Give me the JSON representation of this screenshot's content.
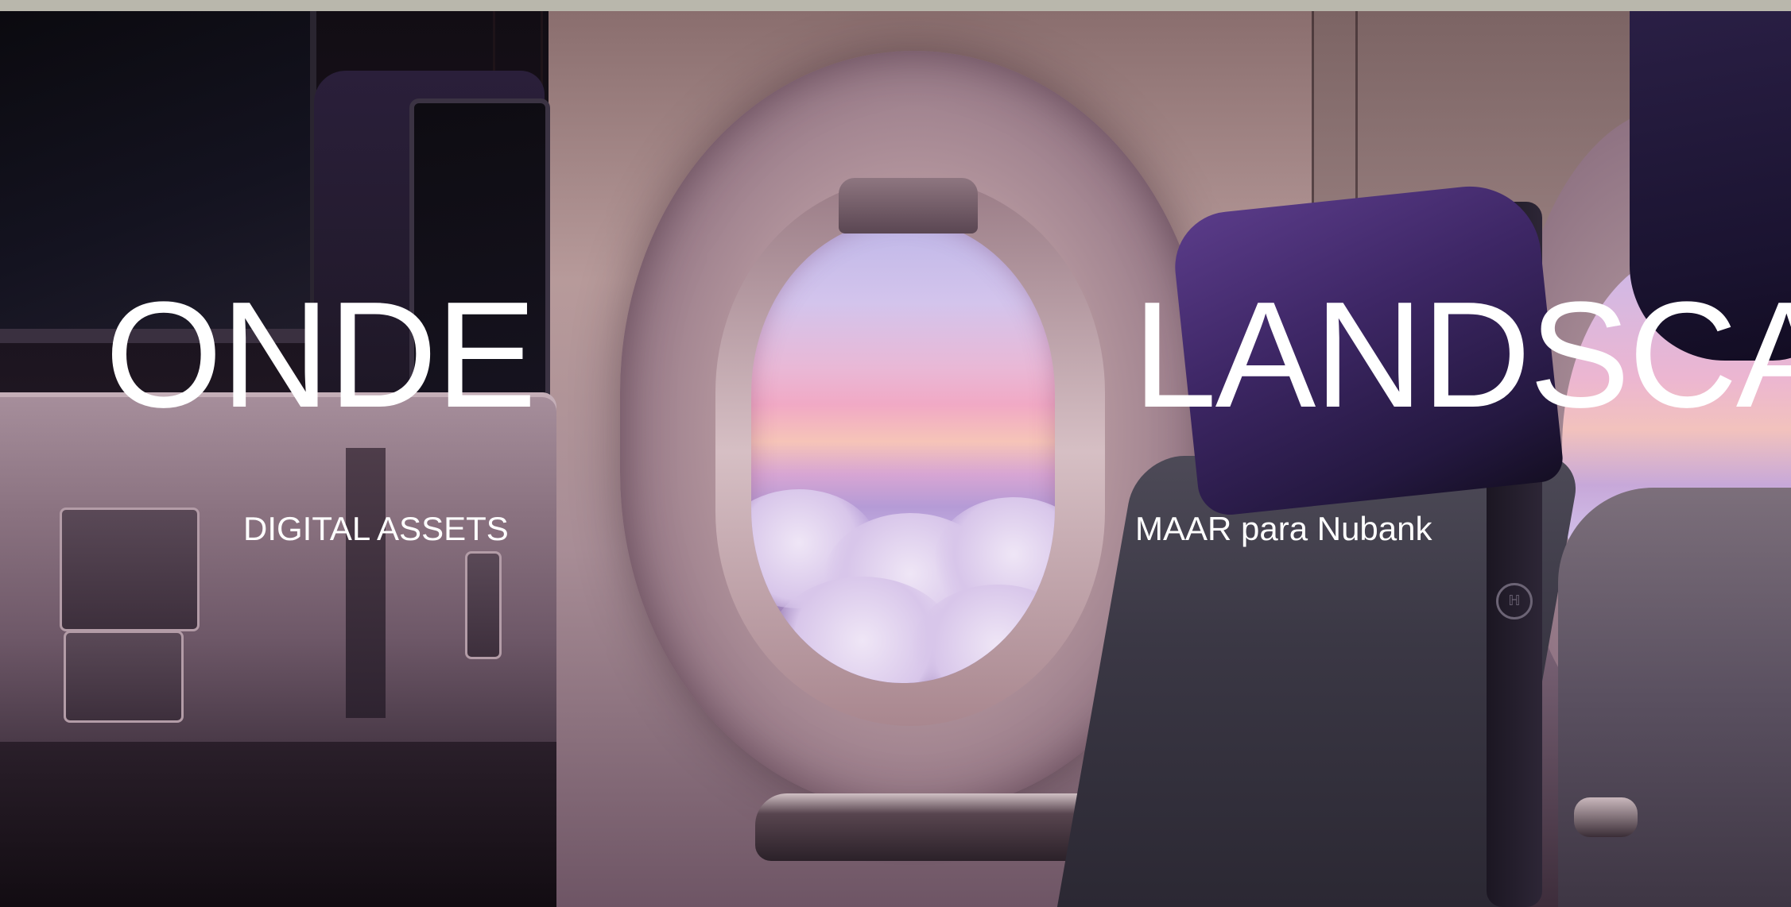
{
  "projects": [
    {
      "title": "ONDE",
      "subtitle": "DIGITAL ASSETS"
    },
    {
      "title": "LANDSCA",
      "subtitle": "MAAR para Nubank"
    }
  ],
  "colors": {
    "top_strip": "#b9b7ac",
    "text": "#ffffff",
    "headrest_accent": "#5b3c8a",
    "sky_pink": "#f1a9c5",
    "sky_lavender": "#bfb7e8"
  },
  "seat_logo_icon": "seat-brand-icon"
}
